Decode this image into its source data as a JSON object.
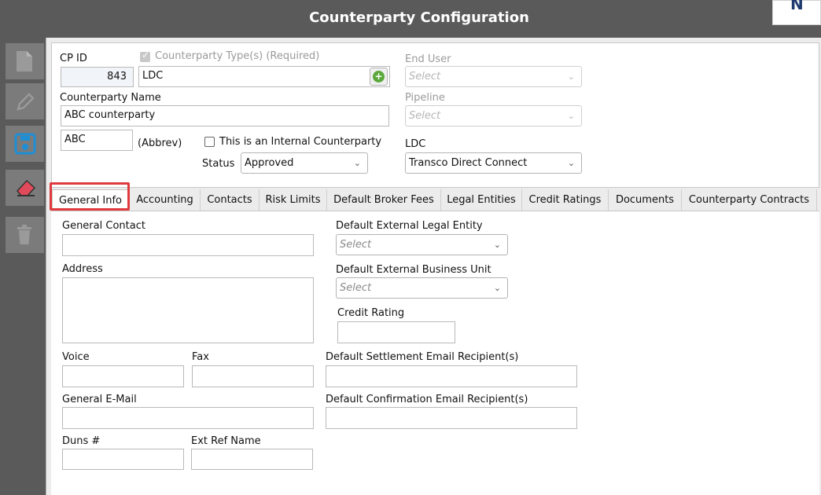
{
  "window": {
    "title": "Counterparty Configuration",
    "corner_glyph": "N"
  },
  "toolbar": {
    "buttons": [
      {
        "name": "new-button",
        "icon": "new-document-icon"
      },
      {
        "name": "edit-button",
        "icon": "pencil-icon"
      },
      {
        "name": "save-button",
        "icon": "floppy-disk-icon"
      },
      {
        "name": "clear-button",
        "icon": "eraser-icon"
      },
      {
        "name": "delete-button",
        "icon": "trash-icon"
      }
    ]
  },
  "header": {
    "cp_id_label": "CP ID",
    "cp_id_value": "843",
    "cp_type_label": "Counterparty Type(s) (Required)",
    "cp_type_value": "LDC",
    "cp_type_checked": true,
    "cp_name_label": "Counterparty Name",
    "cp_name_value": "ABC counterparty",
    "abbrev_value": "ABC",
    "abbrev_label": "(Abbrev)",
    "internal_label": "This is an Internal Counterparty",
    "internal_checked": false,
    "status_label": "Status",
    "status_value": "Approved",
    "end_user_label": "End User",
    "end_user_value": "Select",
    "pipeline_label": "Pipeline",
    "pipeline_value": "Select",
    "ldc_label": "LDC",
    "ldc_value": "Transco Direct Connect"
  },
  "tabs": [
    {
      "label": "General Info",
      "active": true
    },
    {
      "label": "Accounting"
    },
    {
      "label": "Contacts"
    },
    {
      "label": "Risk Limits"
    },
    {
      "label": "Default Broker Fees"
    },
    {
      "label": "Legal Entities"
    },
    {
      "label": "Credit Ratings"
    },
    {
      "label": "Documents"
    },
    {
      "label": "Counterparty Contracts"
    }
  ],
  "general": {
    "general_contact_label": "General Contact",
    "general_contact_value": "",
    "address_label": "Address",
    "address_value": "",
    "voice_label": "Voice",
    "fax_label": "Fax",
    "email_label": "General E-Mail",
    "duns_label": "Duns #",
    "ext_ref_label": "Ext Ref Name",
    "ext_legal_entity_label": "Default External Legal Entity",
    "ext_legal_entity_value": "Select",
    "ext_business_unit_label": "Default External Business Unit",
    "ext_business_unit_value": "Select",
    "credit_rating_label": "Credit Rating",
    "settlement_email_label": "Default Settlement Email Recipient(s)",
    "confirmation_email_label": "Default Confirmation Email Recipient(s)"
  },
  "colors": {
    "chrome": "#5a5a5a",
    "tool_button": "#7b7b7b",
    "accent_highlight": "#e03a3e",
    "save_icon": "#1e8fd6",
    "eraser_icon": "#e04a5a",
    "add_icon": "#5aa83a"
  }
}
